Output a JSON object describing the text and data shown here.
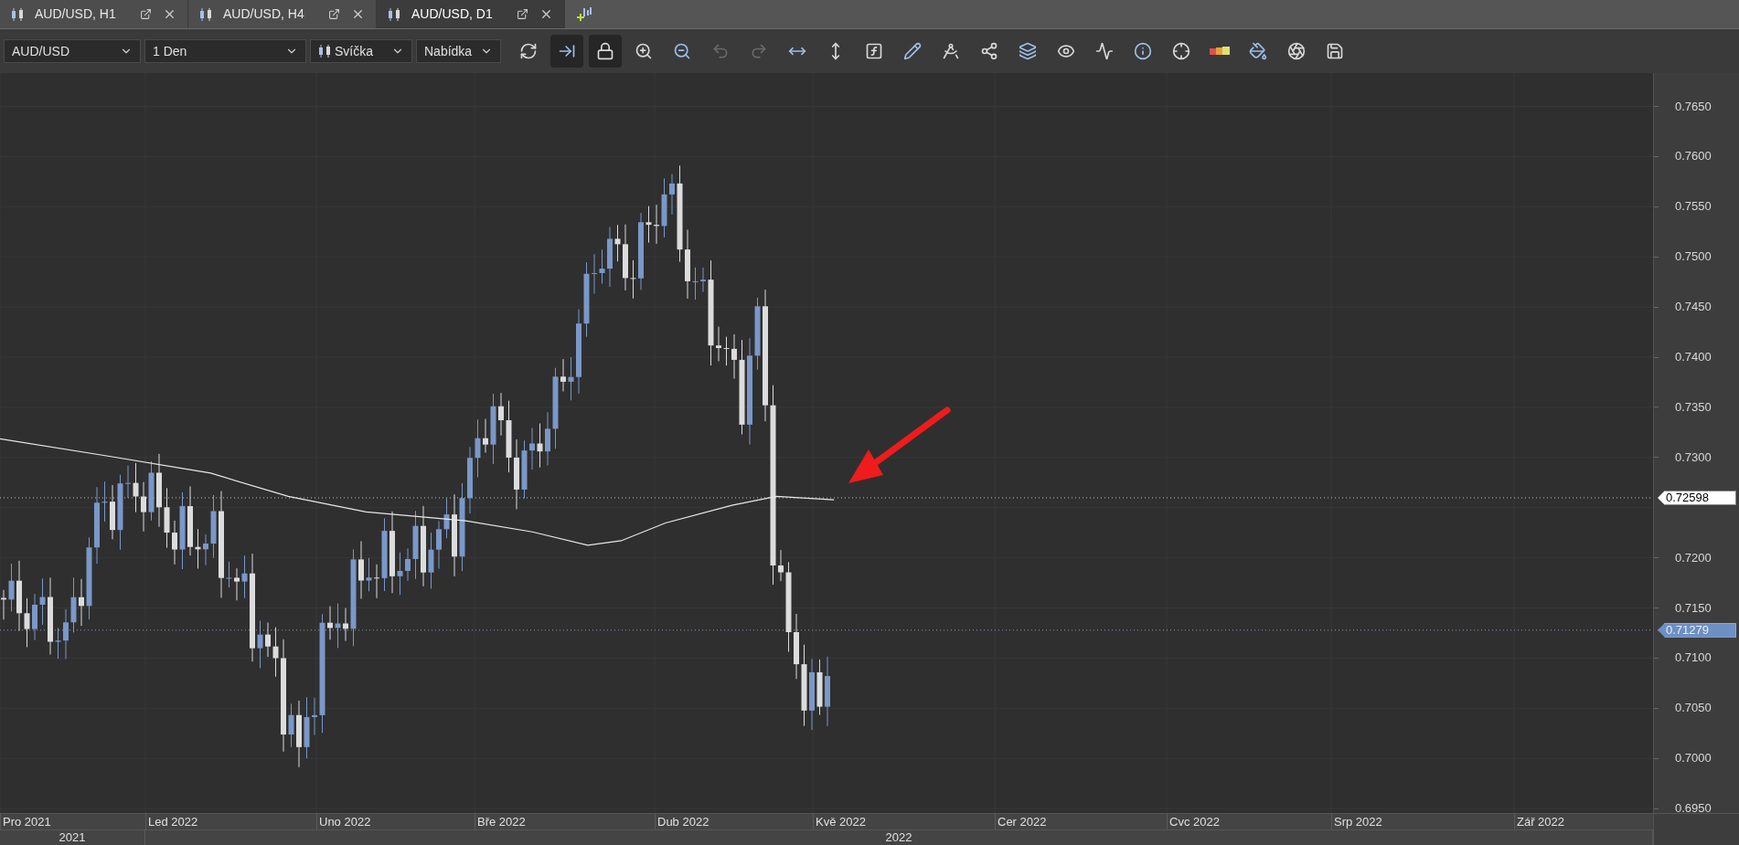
{
  "tabs": [
    {
      "label": "AUD/USD, H1",
      "selected": false
    },
    {
      "label": "AUD/USD, H4",
      "selected": false
    },
    {
      "label": "AUD/USD, D1",
      "selected": true
    }
  ],
  "toolbar": {
    "selects": [
      {
        "value": "AUD/USD",
        "kind": "plain"
      },
      {
        "value": "1 Den",
        "kind": "plain"
      },
      {
        "value": "Svíčka",
        "kind": "candle"
      },
      {
        "value": "Nabídka",
        "kind": "plain"
      }
    ],
    "buttons": [
      {
        "pressed": false,
        "disabled": false
      },
      {
        "pressed": true,
        "disabled": false
      },
      {
        "pressed": true,
        "disabled": false
      },
      {
        "pressed": false,
        "disabled": false
      },
      {
        "pressed": false,
        "disabled": false
      },
      {
        "pressed": false,
        "disabled": true
      },
      {
        "pressed": false,
        "disabled": true
      },
      {
        "pressed": false,
        "disabled": false
      },
      {
        "pressed": false,
        "disabled": false
      },
      {
        "pressed": false,
        "disabled": false
      },
      {
        "pressed": false,
        "disabled": false
      },
      {
        "pressed": false,
        "disabled": false
      },
      {
        "pressed": false,
        "disabled": false
      },
      {
        "pressed": false,
        "disabled": false
      },
      {
        "pressed": false,
        "disabled": false
      },
      {
        "pressed": false,
        "disabled": false
      },
      {
        "pressed": false,
        "disabled": false
      },
      {
        "pressed": false,
        "disabled": false
      },
      {
        "pressed": false,
        "disabled": false
      },
      {
        "pressed": false,
        "disabled": false
      },
      {
        "pressed": false,
        "disabled": false
      },
      {
        "pressed": false,
        "disabled": false
      }
    ]
  },
  "price_axis": [
    "0.7650",
    "0.7600",
    "0.7550",
    "0.7500",
    "0.7450",
    "0.7400",
    "0.7350",
    "0.7300",
    "0.7200",
    "0.7150",
    "0.7100",
    "0.7050",
    "0.7000",
    "0.6950"
  ],
  "price_markers": [
    {
      "label": "0.72598",
      "kind": "average"
    },
    {
      "label": "0.71279",
      "kind": "last"
    }
  ],
  "time_axis": {
    "months": [
      "Pro 2021",
      "Led 2022",
      "Uno 2022",
      "Bře 2022",
      "Dub 2022",
      "Kvě 2022",
      "Cer 2022",
      "Cvc 2022",
      "Srp 2022",
      "Zář 2022"
    ],
    "years": [
      "2021",
      "2022"
    ]
  }
}
